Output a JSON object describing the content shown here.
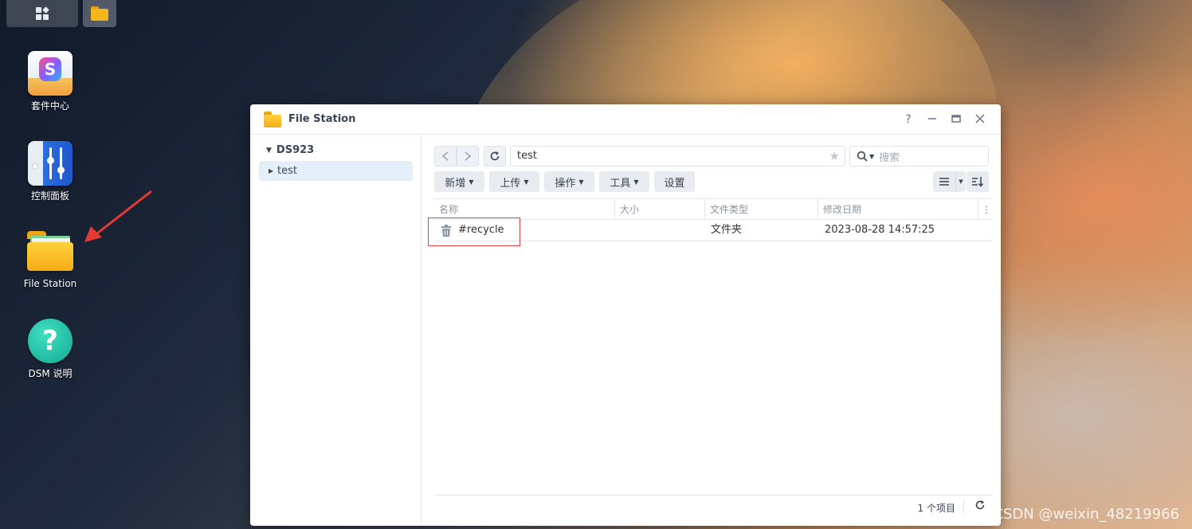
{
  "desktop": {
    "icons": [
      {
        "label": "套件中心",
        "icon": "package-center-icon"
      },
      {
        "label": "控制面板",
        "icon": "control-panel-icon"
      },
      {
        "label": "File Station",
        "icon": "folder-icon"
      },
      {
        "label": "DSM 说明",
        "icon": "help-icon"
      }
    ],
    "watermark": "CSDN @weixin_48219966",
    "accent_arrow_color": "#e53935"
  },
  "window": {
    "title": "File Station",
    "controls": {
      "help": "?",
      "minimize": "—",
      "maximize": "□",
      "close": "✕"
    }
  },
  "sidebar": {
    "root_label": "DS923",
    "items": [
      {
        "label": "test"
      }
    ]
  },
  "toolbar": {
    "path": "test",
    "search_placeholder": "搜索",
    "buttons": {
      "new": "新增",
      "upload": "上传",
      "action": "操作",
      "tools": "工具",
      "settings": "设置"
    }
  },
  "table": {
    "columns": [
      "名称",
      "大小",
      "文件类型",
      "修改日期"
    ],
    "rows": [
      {
        "name": "#recycle",
        "size": "",
        "type": "文件夹",
        "modified": "2023-08-28 14:57:25"
      }
    ]
  },
  "status": {
    "count": "1 个项目"
  },
  "colors": {
    "selected_tree_bg": "#e5effa",
    "highlight_box": "#e34040",
    "folder_yellow": "#f6ad17"
  }
}
